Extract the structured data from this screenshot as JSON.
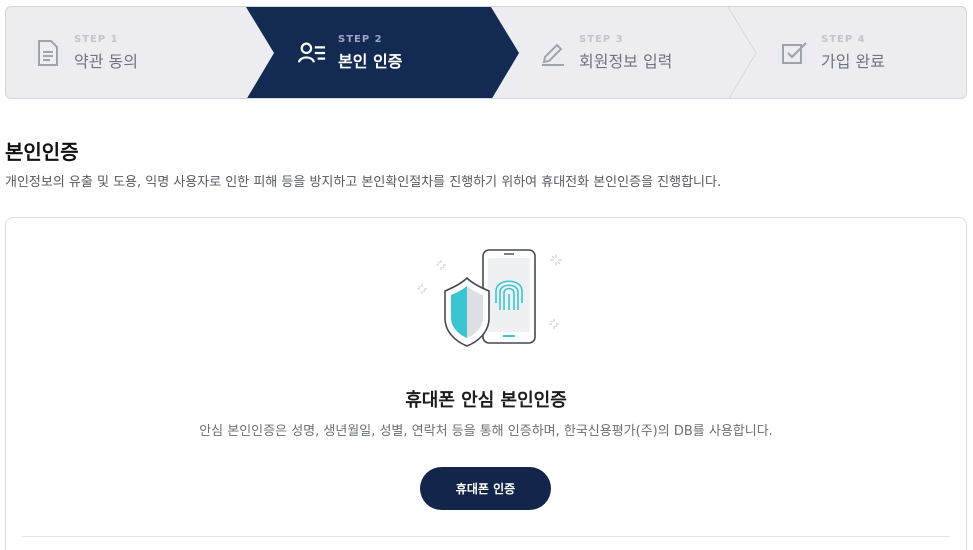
{
  "stepper": {
    "steps": [
      {
        "num": "STEP 1",
        "label": "약관 동의",
        "icon": "document-icon",
        "state": "inactive"
      },
      {
        "num": "STEP 2",
        "label": "본인 인증",
        "icon": "user-verify-icon",
        "state": "active"
      },
      {
        "num": "STEP 3",
        "label": "회원정보 입력",
        "icon": "pencil-icon",
        "state": "inactive"
      },
      {
        "num": "STEP 4",
        "label": "가입 완료",
        "icon": "checkbox-icon",
        "state": "inactive"
      }
    ]
  },
  "intro": {
    "title": "본인인증",
    "description": "개인정보의 유출 및 도용, 익명 사용자로 인한 피해 등을 방지하고 본인확인절차를 진행하기 위하여 휴대전화 본인인증을 진행합니다."
  },
  "card": {
    "illustration": "phone-shield-fingerprint-icon",
    "title": "휴대폰 안심 본인인증",
    "description": "안심 본인인증은 성명, 생년월일, 성별, 연락처 등을 통해 인증하며, 한국신용평가(주)의 DB를 사용합니다.",
    "button_label": "휴대폰 인증"
  },
  "colors": {
    "active_step": "#132a52",
    "primary_button": "#12254a",
    "accent_teal": "#3bc5d1"
  }
}
